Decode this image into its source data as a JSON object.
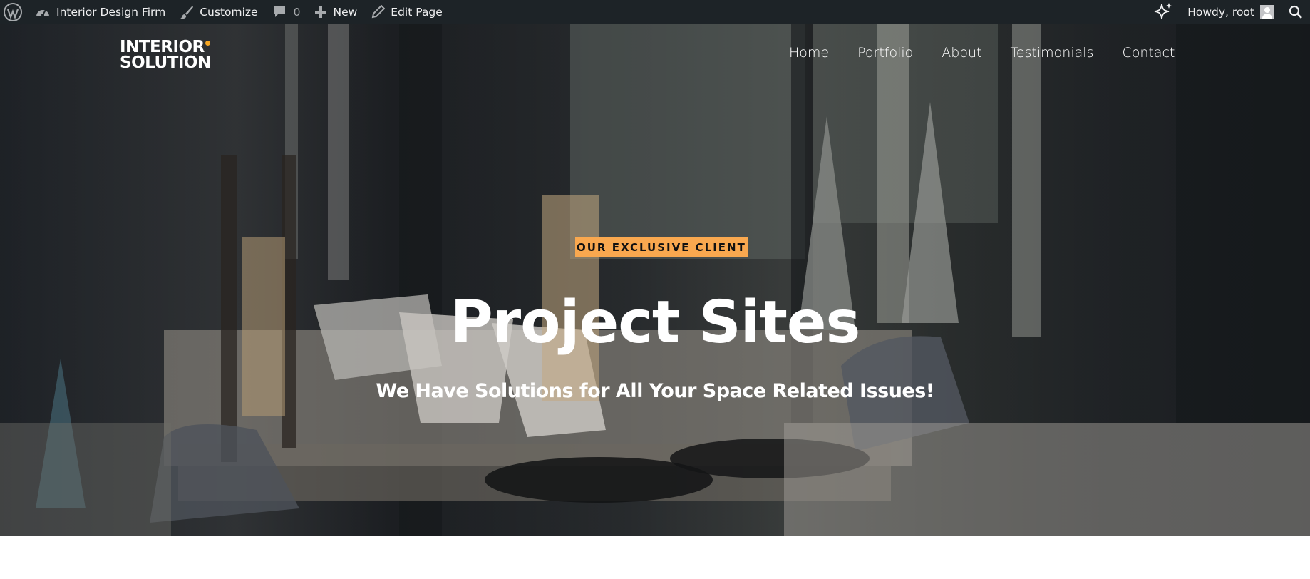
{
  "adminbar": {
    "site_name": "Interior Design Firm",
    "customize": "Customize",
    "comments_count": "0",
    "new_label": "New",
    "edit_page": "Edit Page",
    "howdy": "Howdy, root"
  },
  "header": {
    "logo_line1": "INTERIOR",
    "logo_line2": "SOLUTION",
    "accent": "#f5a623",
    "nav": [
      {
        "label": "Home"
      },
      {
        "label": "Portfolio"
      },
      {
        "label": "About"
      },
      {
        "label": "Testimonials"
      },
      {
        "label": "Contact"
      }
    ]
  },
  "hero": {
    "kicker": "OUR EXCLUSIVE CLIENT",
    "kicker_bg": "#f9a84f",
    "title": "Project Sites",
    "subtitle": "We Have Solutions for All Your Space Related Issues!"
  },
  "colors": {
    "adminbar_bg": "#1d2327",
    "adminbar_text": "#f0f0f1",
    "icon_gray": "#a7aaad"
  }
}
